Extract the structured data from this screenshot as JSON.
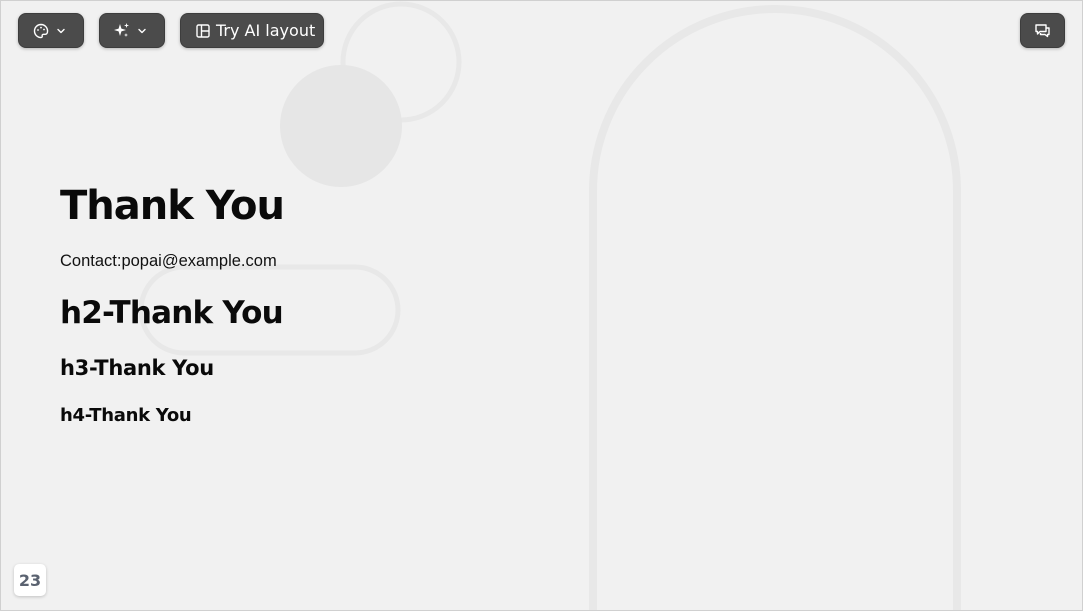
{
  "toolbar": {
    "theme_icon": "palette-icon",
    "magic_icon": "sparkles-icon",
    "layout_icon": "layout-icon",
    "layout_label": "Try AI layout",
    "comment_icon": "comment-icon",
    "dropdown_icon": "chevron-down-icon"
  },
  "slide": {
    "title": "Thank You",
    "contact": "Contact:popai@example.com",
    "h2": "h2-Thank You",
    "h3": "h3-Thank You",
    "h4": "h4-Thank You",
    "page_number": "23"
  },
  "colors": {
    "background": "#f1f1f1",
    "toolbar_button": "#4b4b4b",
    "decor_fill": "#e6e6e6",
    "decor_stroke": "#e8e8e8",
    "text": "#0a0a0a"
  }
}
